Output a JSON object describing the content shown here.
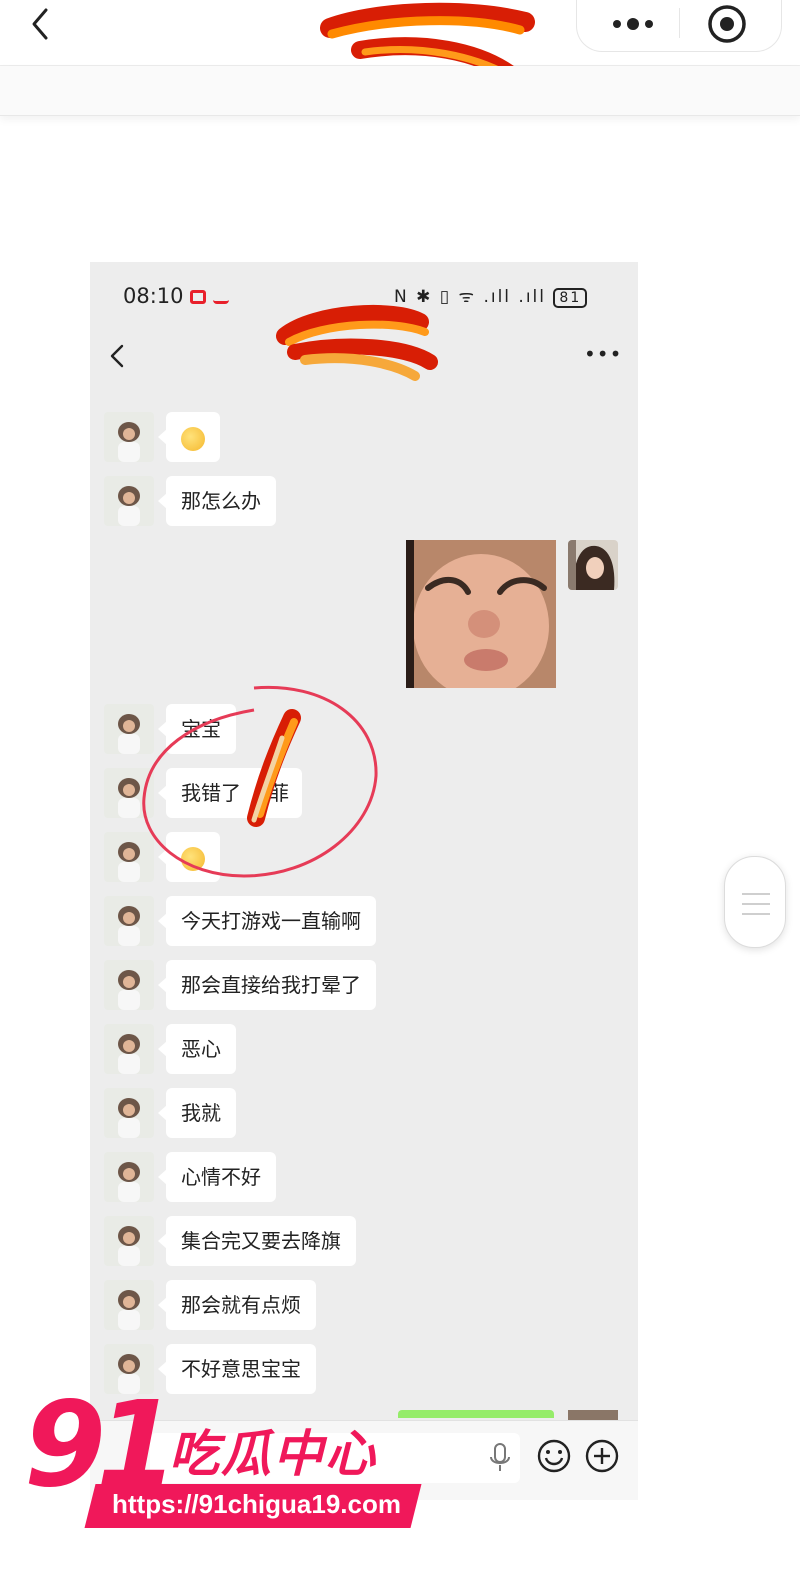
{
  "phone": {
    "status": {
      "time": "08:10",
      "icons": "N ✱ ▯ ᯤ .ıll .ıll",
      "battery": "81"
    },
    "messages": [
      {
        "text": ""
      },
      {
        "text": "那怎么办"
      },
      {
        "text": "宝宝"
      },
      {
        "text": "我错了"
      },
      {
        "text": ""
      },
      {
        "text": "今天打游戏一直输啊"
      },
      {
        "text": "那会直接给我打晕了"
      },
      {
        "text": "恶心"
      },
      {
        "text": "我就"
      },
      {
        "text": "心情不好"
      },
      {
        "text": "集合完又要去降旗"
      },
      {
        "text": "那会就有点烦"
      },
      {
        "text": "不好意思宝宝"
      }
    ],
    "partial_text": "菲"
  },
  "watermark": {
    "number": "91",
    "name": "吃瓜中心",
    "url": "https://91chigua19.com"
  },
  "colors": {
    "brand": "#f0185a",
    "chat_bg": "#ededed",
    "self_bubble": "#95ec69"
  }
}
